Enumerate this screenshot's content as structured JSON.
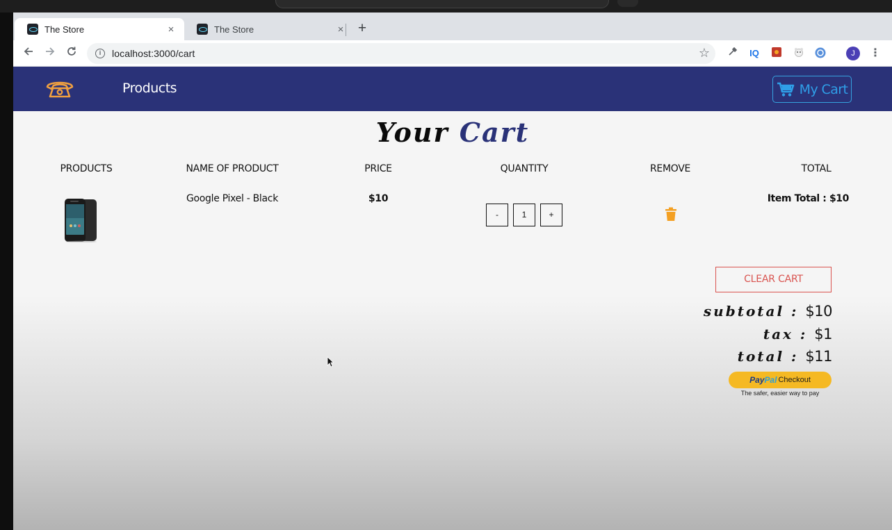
{
  "browser": {
    "tabs": [
      {
        "title": "The Store",
        "close": "×",
        "active": true
      },
      {
        "title": "The Store",
        "close": "×",
        "active": false
      }
    ],
    "new_tab": "+",
    "url": "localhost:3000/cart",
    "avatar_letter": "J",
    "extensions": [
      "eyedropper-icon",
      "iq-icon",
      "puzzle-icon",
      "bear-icon",
      "react-devtools-icon"
    ]
  },
  "navbar": {
    "logo": "phone-logo-icon",
    "products_link": "Products",
    "cart_button": "My Cart",
    "colors": {
      "background": "#2a3278",
      "logo": "#f0a040",
      "cart": "#2f9fe8"
    }
  },
  "cart": {
    "title_part1": "Your",
    "title_part2": "Cart",
    "columns": [
      "PRODUCTS",
      "NAME OF PRODUCT",
      "PRICE",
      "QUANTITY",
      "REMOVE",
      "TOTAL"
    ],
    "items": [
      {
        "image": "phone-image",
        "name": "Google Pixel - Black",
        "price": "$10",
        "decrement": "-",
        "quantity": "1",
        "increment": "+",
        "remove": "trash-icon",
        "item_total": "Item Total : $10"
      }
    ],
    "clear_button": "CLEAR CART",
    "totals": {
      "subtotal_label": "subtotal :",
      "subtotal_value": "$10",
      "tax_label": "tax :",
      "tax_value": "$1",
      "total_label": "total :",
      "total_value": "$11"
    },
    "paypal": {
      "brand_a": "Pay",
      "brand_b": "Pal",
      "button_text": "Checkout",
      "tagline": "The safer, easier way to pay"
    }
  }
}
